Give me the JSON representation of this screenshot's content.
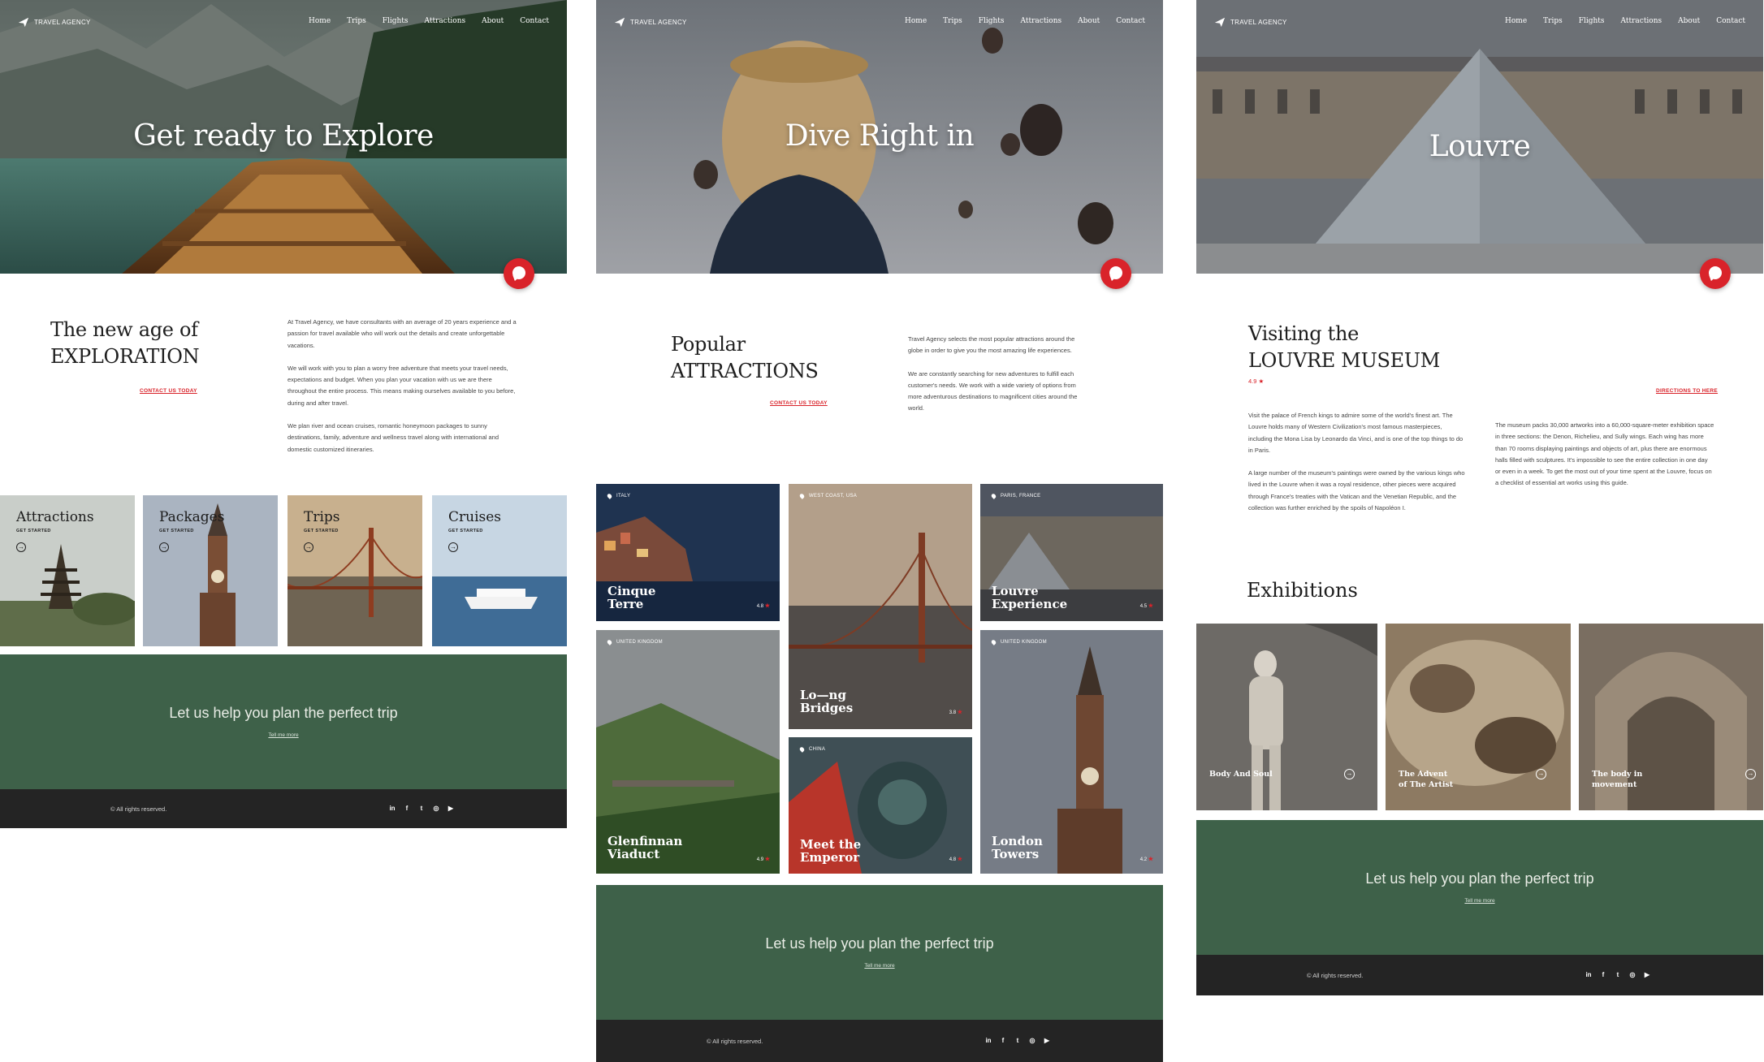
{
  "brand": "TRAVEL AGENCY",
  "nav": [
    "Home",
    "Trips",
    "Flights",
    "Attractions",
    "About",
    "Contact"
  ],
  "icons": {
    "logo": "plane-icon",
    "chat": "chat-bubble-icon",
    "pin": "location-pin-icon",
    "arrow": "arrow-circle-right-icon",
    "star": "star-icon"
  },
  "colors": {
    "accent_red": "#d9232a",
    "cta_green": "#3e6149",
    "footer_dark": "#242424"
  },
  "page1": {
    "hero_title": "Get ready to Explore",
    "intro_title_1": "The new age of",
    "intro_title_2": "EXPLORATION",
    "contact_link": "CONTACT US TODAY",
    "p1": "At Travel Agency, we have consultants with an average of 20 years experience and a passion for travel available who will work out the details and create unforgettable vacations.",
    "p2": "We will work with you to plan a worry free adventure that meets your travel needs, expectations and budget. When you plan your vacation with us we are there throughout the entire process.  This means making ourselves available to you before, during and after travel.",
    "p3": "We plan river and ocean cruises, romantic honeymoon packages to sunny destinations, family, adventure and wellness travel along with international and domestic customized itineraries.",
    "categories": [
      {
        "title": "Attractions",
        "sub": "GET STARTED"
      },
      {
        "title": "Packages",
        "sub": "GET STARTED"
      },
      {
        "title": "Trips",
        "sub": "GET STARTED"
      },
      {
        "title": "Cruises",
        "sub": "GET STARTED"
      }
    ],
    "cta_title": "Let us help you plan the perfect trip",
    "cta_link": "Tell me more",
    "copyright": "© All rights reserved."
  },
  "page2": {
    "hero_title": "Dive Right in",
    "intro_title_1": "Popular",
    "intro_title_2": "ATTRACTIONS",
    "contact_link": "CONTACT US TODAY",
    "p1": "Travel Agency selects the most popular attractions around the globe in order to give you the most amazing life experiences.",
    "p2": "We are constantly searching for new adventures to fulfill each customer's needs. We work with a wide variety of options from more adventurous destinations to magnificent cities around the world.",
    "attractions": [
      {
        "location": "ITALY",
        "name1": "Cinque",
        "name2": "Terre",
        "rating": "4.8"
      },
      {
        "location": "WEST COAST, USA",
        "name1": "Lo—ng",
        "name2": "Bridges",
        "rating": "3.8"
      },
      {
        "location": "PARIS, FRANCE",
        "name1": "Louvre",
        "name2": "Experience",
        "rating": "4.5"
      },
      {
        "location": "UNITED KINGDOM",
        "name1": "Glenfinnan",
        "name2": "Viaduct",
        "rating": "4.9"
      },
      {
        "location": "CHINA",
        "name1": "Meet the",
        "name2": "Emperor",
        "rating": "4.8"
      },
      {
        "location": "UNITED KINGDOM",
        "name1": "London",
        "name2": "Towers",
        "rating": "4.2"
      }
    ],
    "cta_title": "Let us help you plan the perfect trip",
    "cta_link": "Tell me more",
    "copyright": "© All rights reserved."
  },
  "page3": {
    "hero_title": "Louvre",
    "intro_title_1": "Visiting the",
    "intro_title_2": "LOUVRE MUSEUM",
    "rating": "4.9",
    "directions_link": "DIRECTIONS TO HERE",
    "p1": "Visit the palace of French kings to admire some of the world's finest art. The Louvre holds many of Western Civilization's most famous masterpieces, including the Mona Lisa by Leonardo da Vinci, and is one of the top things to do in Paris.",
    "p2": "A large number of the museum's paintings were owned by the various kings who lived in the Louvre when it was a royal residence, other pieces were acquired through France's treaties with the Vatican and the Venetian Republic, and the collection was further enriched by the spoils of Napoléon I.",
    "p3": "The museum packs 30,000 artworks into a 60,000-square-meter exhibition space in three sections: the Denon, Richelieu, and Sully wings. Each wing has more than 70 rooms displaying paintings and objects of art, plus there are enormous halls filled with sculptures. It's impossible to see the entire collection in one day or even in a week. To get the most out of your time spent at the Louvre, focus on a checklist of essential art works using this guide.",
    "exhibitions_title": "Exhibitions",
    "exhibitions": [
      {
        "name1": "Body And Soul",
        "name2": ""
      },
      {
        "name1": "The Advent",
        "name2": "of The Artist"
      },
      {
        "name1": "The body in",
        "name2": "movement"
      }
    ],
    "cta_title": "Let us help you plan the perfect trip",
    "cta_link": "Tell me more",
    "copyright": "© All rights reserved."
  },
  "social": [
    "in",
    "f",
    "t",
    "ig",
    "yt"
  ]
}
